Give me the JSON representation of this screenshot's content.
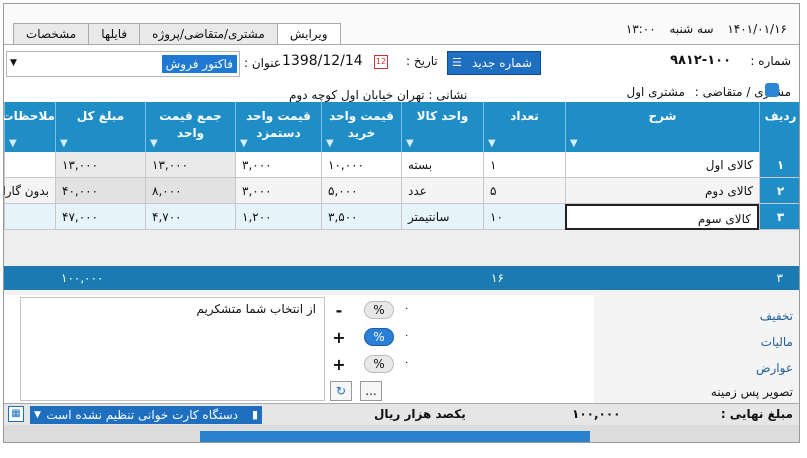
{
  "status": {
    "time": "۱۳:۰۰",
    "weekday": "سه شنبه",
    "date": "۱۴۰۱/۰۱/۱۶"
  },
  "tabs": [
    "ویرایش",
    "مشتری/متقاضی/پروژه",
    "فایلها",
    "مشخصات"
  ],
  "header": {
    "number_label": "شماره :",
    "number_value": "۹۸۱۲-۱۰۰",
    "new_number_button": "شماره جدید",
    "date_label": "تاریخ :",
    "date_value": "1398/12/14",
    "title_label": "عنوان :",
    "title_value": "فاکتور فروش",
    "customer_label": "مشتری / متقاضی :",
    "customer_value": "مشتری اول",
    "address_label": "نشانی :",
    "address_value": "تهران خیابان اول کوچه دوم"
  },
  "grid": {
    "columns": [
      "ردیف",
      "شرح",
      "تعداد",
      "واحد کالا",
      "قیمت واحد خرید",
      "قیمت واحد دستمزد",
      "جمع قیمت واحد",
      "مبلغ کل",
      "ملاحظات"
    ],
    "rows": [
      {
        "idx": "۱",
        "desc": "کالای اول",
        "qty": "۱",
        "unit": "بسته",
        "buy": "۱۰,۰۰۰",
        "labor": "۳,۰۰۰",
        "sum": "۱۳,۰۰۰",
        "total": "۱۳,۰۰۰",
        "note": ""
      },
      {
        "idx": "۲",
        "desc": "کالای دوم",
        "qty": "۵",
        "unit": "عدد",
        "buy": "۵,۰۰۰",
        "labor": "۳,۰۰۰",
        "sum": "۸,۰۰۰",
        "total": "۴۰,۰۰۰",
        "note": "بدون گارانتی"
      },
      {
        "idx": "۳",
        "desc": "کالای سوم",
        "qty": "۱۰",
        "unit": "سانتیمتر",
        "buy": "۳,۵۰۰",
        "labor": "۱,۲۰۰",
        "sum": "۴,۷۰۰",
        "total": "۴۷,۰۰۰",
        "note": ""
      }
    ],
    "footer": {
      "count": "۳",
      "qty_total": "۱۶",
      "amount_total": "۱۰۰,۰۰۰"
    }
  },
  "adjustments": {
    "discount_label": "تخفیف",
    "tax_label": "مالیات",
    "duties_label": "عوارض",
    "background_label": "تصویر پس زمینه",
    "percent": "%",
    "value": "۰",
    "plus": "+",
    "minus": "-",
    "more": "..."
  },
  "notes_text": "از انتخاب شما متشکریم",
  "totals": {
    "final_label": "مبلغ نهایی :",
    "final_value": "۱۰۰,۰۰۰",
    "words": "یکصد هزار ریال"
  },
  "card_reader": "دستگاه کارت خوانی تنظیم نشده است"
}
